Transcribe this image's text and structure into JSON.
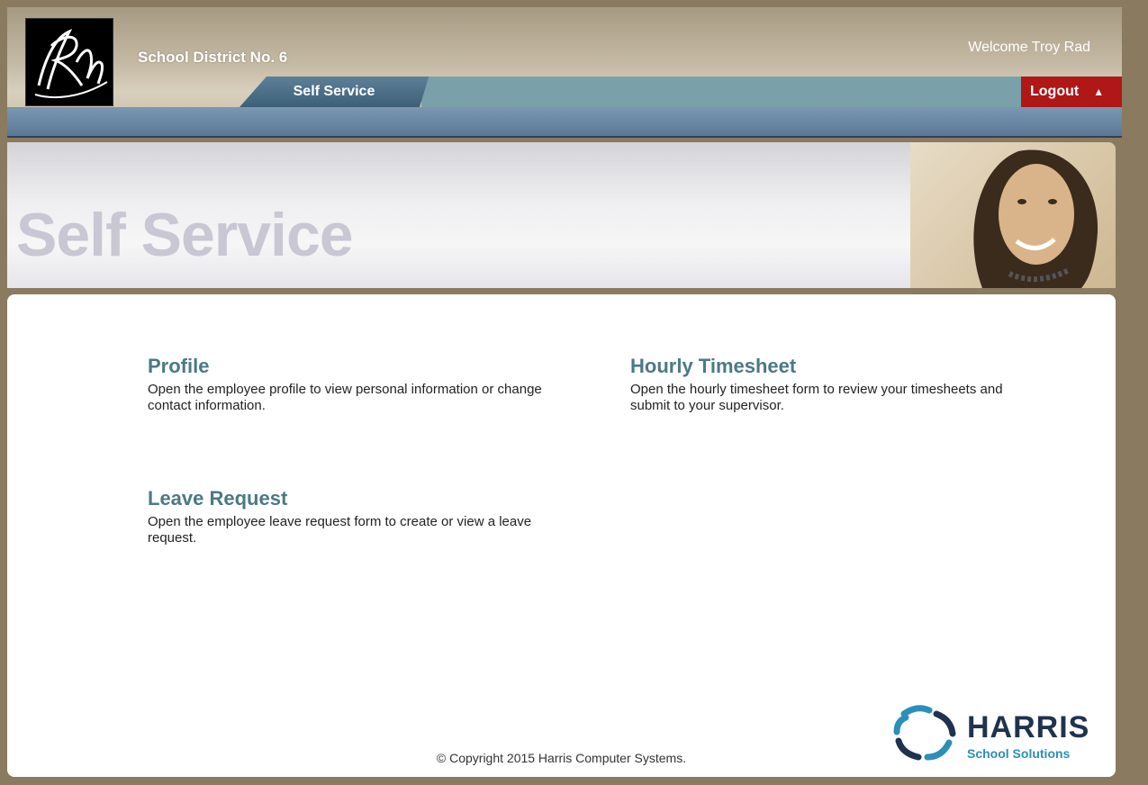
{
  "header": {
    "district_name": "School District No. 6",
    "welcome_text": "Welcome Troy Rad",
    "logo_letters": "RM"
  },
  "nav": {
    "tab_label": "Self Service",
    "logout_label": "Logout",
    "logout_icon": "triangle-up-icon"
  },
  "banner": {
    "title": "Self Service"
  },
  "menu": {
    "profile": {
      "title": "Profile",
      "description": "Open the employee profile to view personal information or change contact information."
    },
    "timesheet": {
      "title": "Hourly Timesheet",
      "description": "Open the hourly timesheet form to review your timesheets and submit to your supervisor."
    },
    "leave": {
      "title": "Leave Request",
      "description": "Open the employee leave request form to create or view a leave request."
    }
  },
  "footer": {
    "copyright": "© Copyright 2015 Harris Computer Systems.",
    "brand_name": "HARRIS",
    "brand_sub": "School Solutions"
  },
  "colors": {
    "frame": "#8a7a60",
    "tab": "#3e5f78",
    "logout": "#b01717",
    "link": "#4a7a85"
  }
}
